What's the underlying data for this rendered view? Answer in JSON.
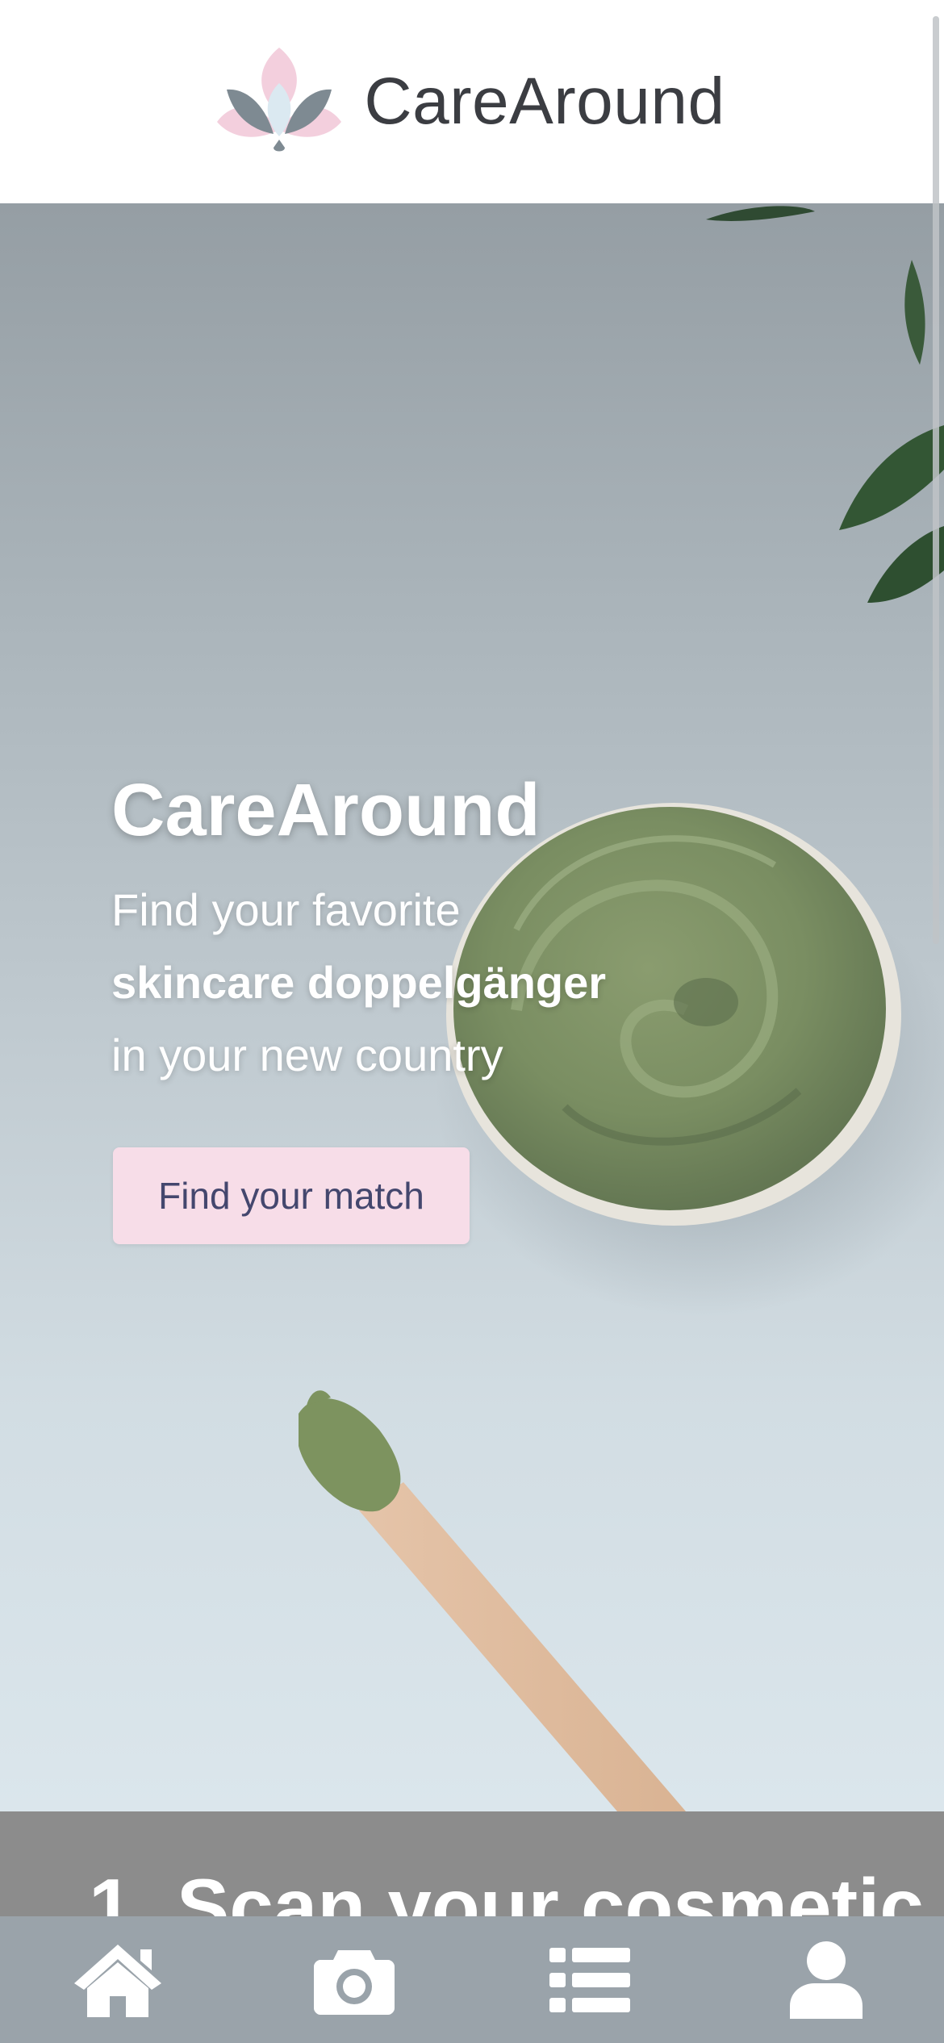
{
  "header": {
    "brand_name": "CareAround",
    "logo_icon": "lotus-logo-icon"
  },
  "hero": {
    "title": "CareAround",
    "line1": "Find your favorite",
    "line2": "skincare doppelgänger",
    "line3": "in your new country",
    "cta_label": "Find your match"
  },
  "next_section": {
    "title": "1. Scan your cosmetic"
  },
  "bottom_nav": {
    "items": [
      {
        "icon": "home-icon"
      },
      {
        "icon": "camera-icon"
      },
      {
        "icon": "list-icon"
      },
      {
        "icon": "user-icon"
      }
    ]
  },
  "colors": {
    "brand_text": "#3b3d42",
    "cta_bg": "#f7dde8",
    "cta_text": "#44476e",
    "nav_bg": "#9aa3aa",
    "logo_pink": "#f3cfdd",
    "logo_gray": "#7e8a92",
    "logo_blue": "#dbe9f1"
  }
}
